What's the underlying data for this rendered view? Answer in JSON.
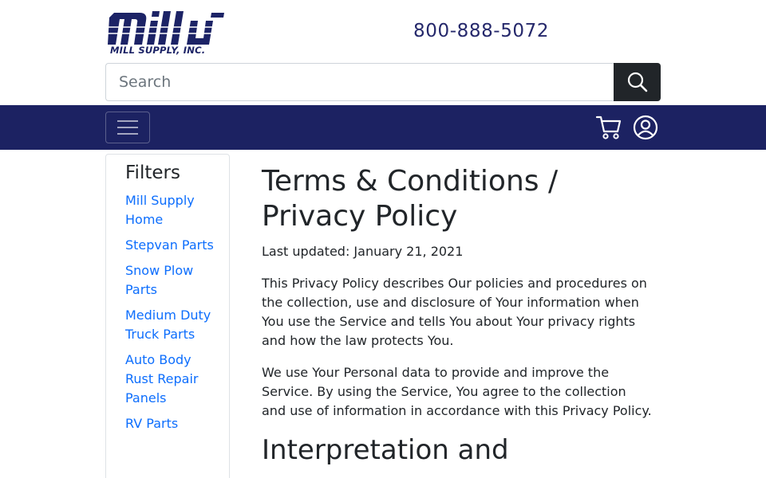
{
  "header": {
    "logo_mark": "mill",
    "logo_text": "MILL SUPPLY, INC.",
    "phone": "800-888-5072",
    "search": {
      "placeholder": "Search",
      "value": ""
    }
  },
  "navbar": {
    "icons": [
      "hamburger-menu-icon",
      "cart-icon",
      "account-icon"
    ],
    "background": "#1c2262"
  },
  "sidebar": {
    "title": "Filters",
    "items": [
      {
        "label": "Mill Supply Home"
      },
      {
        "label": "Stepvan Parts"
      },
      {
        "label": "Snow Plow Parts"
      },
      {
        "label": "Medium Duty Truck Parts"
      },
      {
        "label": "Auto Body Rust Repair Panels"
      },
      {
        "label": "RV Parts"
      }
    ]
  },
  "main": {
    "title": "Terms & Conditions / Privacy Policy",
    "last_updated": "Last updated: January 21, 2021",
    "paragraphs": [
      "This Privacy Policy describes Our policies and procedures on the collection, use and disclosure of Your information when You use the Service and tells You about Your privacy rights and how the law protects You.",
      "We use Your Personal data to provide and improve the Service. By using the Service, You agree to the collection and use of information in accordance with this Privacy Policy."
    ],
    "section_heading": "Interpretation and"
  },
  "colors": {
    "brand_navy": "#1c2262",
    "link": "#0d6efd",
    "search_button": "#212529"
  }
}
